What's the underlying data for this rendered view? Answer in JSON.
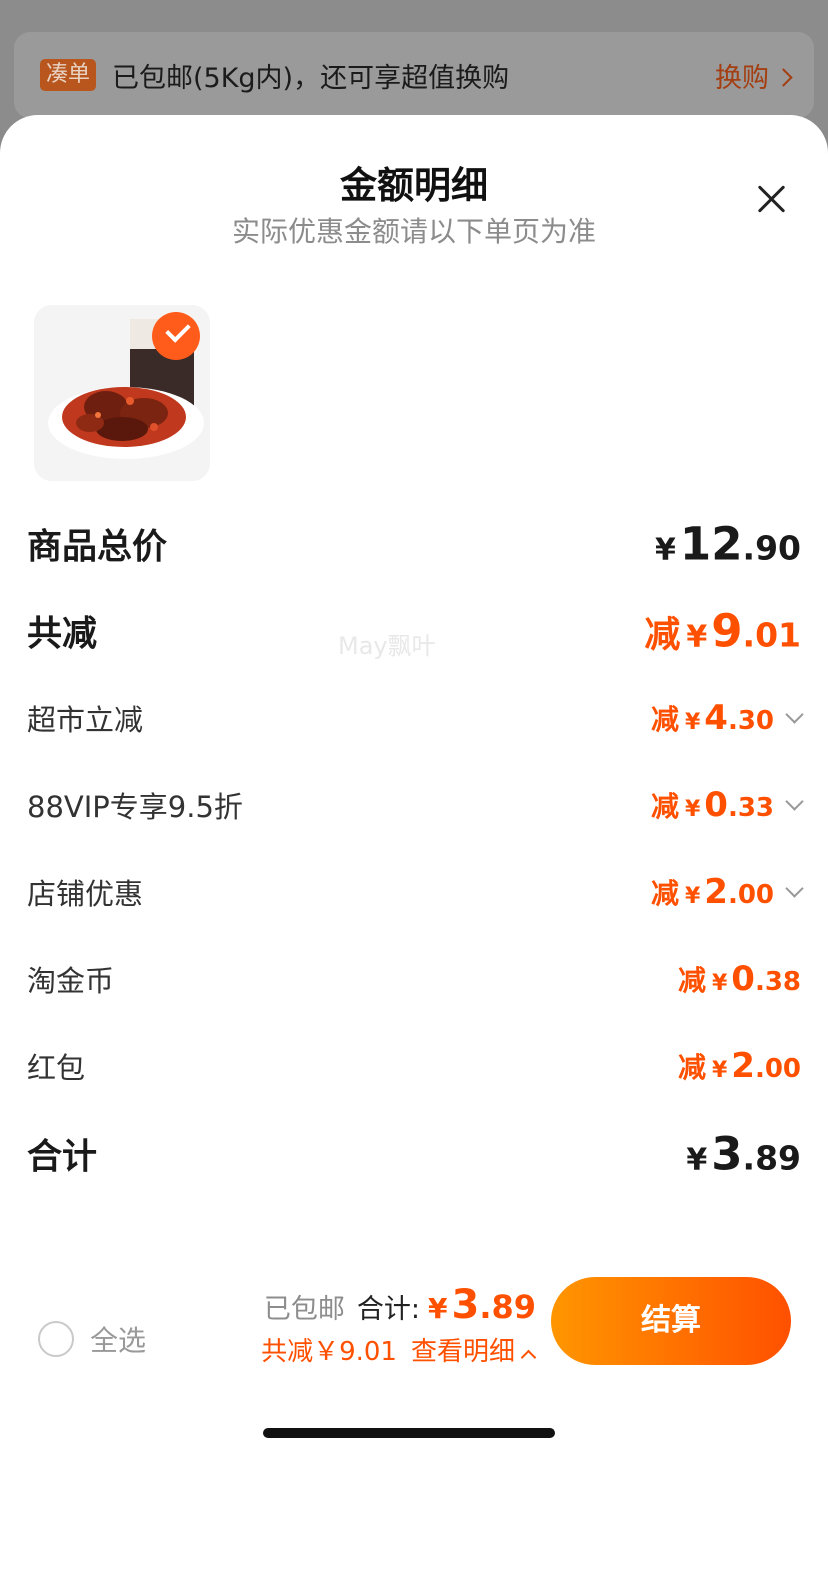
{
  "promo": {
    "tag": "凑单",
    "text": "已包邮(5Kg内)，还可享超值换购",
    "link": "换购"
  },
  "sheet": {
    "title": "金额明细",
    "subtitle": "实际优惠金额请以下单页为准"
  },
  "rows": {
    "goods_total": {
      "label": "商品总价",
      "symbol": "¥",
      "int": "12",
      "dec": ".90"
    },
    "total_discount": {
      "label": "共减",
      "prefix": "减",
      "symbol": "¥",
      "int": "9",
      "dec": ".01"
    },
    "supermarket": {
      "label": "超市立减",
      "prefix": "减",
      "symbol": "¥",
      "int": "4",
      "dec": ".30"
    },
    "vip": {
      "label": "88VIP专享9.5折",
      "prefix": "减",
      "symbol": "¥",
      "int": "0",
      "dec": ".33"
    },
    "store": {
      "label": "店铺优惠",
      "prefix": "减",
      "symbol": "¥",
      "int": "2",
      "dec": ".00"
    },
    "coins": {
      "label": "淘金币",
      "prefix": "减",
      "symbol": "¥",
      "int": "0",
      "dec": ".38"
    },
    "redpacket": {
      "label": "红包",
      "prefix": "减",
      "symbol": "¥",
      "int": "2",
      "dec": ".00"
    },
    "total": {
      "label": "合计",
      "symbol": "¥",
      "int": "3",
      "dec": ".89"
    }
  },
  "watermark": "May飘叶",
  "footer": {
    "select_all": "全选",
    "free_shipping": "已包邮",
    "total_label": "合计:",
    "total_symbol": "¥",
    "total_int": "3",
    "total_dec": ".89",
    "discount_text": "共减￥9.01",
    "details_link": "查看明细",
    "checkout": "结算"
  },
  "colors": {
    "accent": "#ff5000",
    "button_gradient_start": "#ff9600",
    "button_gradient_end": "#ff5000"
  }
}
